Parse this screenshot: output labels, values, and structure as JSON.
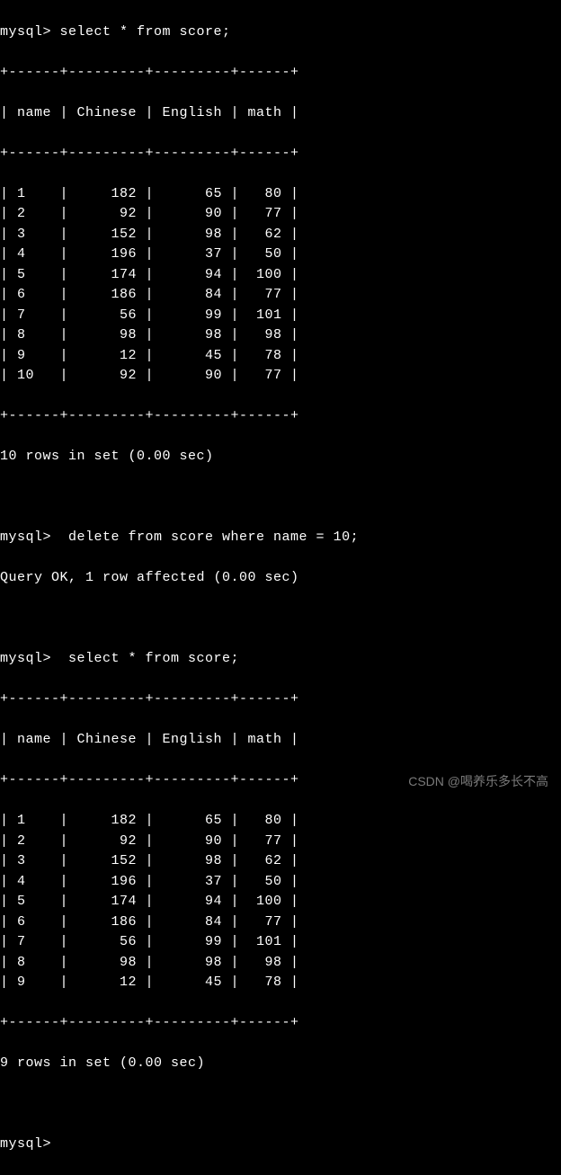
{
  "prompt": "mysql>",
  "queries": {
    "select1": " select * from score;",
    "delete": "  delete from score where name = 10;",
    "select2": "  select * from score;"
  },
  "headers": {
    "name": "name",
    "chinese": "Chinese",
    "english": "English",
    "math": "math"
  },
  "separator_top": "+------+---------+---------+------+",
  "separator": "+------+---------+---------+------+",
  "table1": [
    {
      "name": "1",
      "chinese": "182",
      "english": "65",
      "math": "80"
    },
    {
      "name": "2",
      "chinese": "92",
      "english": "90",
      "math": "77"
    },
    {
      "name": "3",
      "chinese": "152",
      "english": "98",
      "math": "62"
    },
    {
      "name": "4",
      "chinese": "196",
      "english": "37",
      "math": "50"
    },
    {
      "name": "5",
      "chinese": "174",
      "english": "94",
      "math": "100"
    },
    {
      "name": "6",
      "chinese": "186",
      "english": "84",
      "math": "77"
    },
    {
      "name": "7",
      "chinese": "56",
      "english": "99",
      "math": "101"
    },
    {
      "name": "8",
      "chinese": "98",
      "english": "98",
      "math": "98"
    },
    {
      "name": "9",
      "chinese": "12",
      "english": "45",
      "math": "78"
    },
    {
      "name": "10",
      "chinese": "92",
      "english": "90",
      "math": "77"
    }
  ],
  "result1": "10 rows in set (0.00 sec)",
  "delete_result": "Query OK, 1 row affected (0.00 sec)",
  "table2": [
    {
      "name": "1",
      "chinese": "182",
      "english": "65",
      "math": "80"
    },
    {
      "name": "2",
      "chinese": "92",
      "english": "90",
      "math": "77"
    },
    {
      "name": "3",
      "chinese": "152",
      "english": "98",
      "math": "62"
    },
    {
      "name": "4",
      "chinese": "196",
      "english": "37",
      "math": "50"
    },
    {
      "name": "5",
      "chinese": "174",
      "english": "94",
      "math": "100"
    },
    {
      "name": "6",
      "chinese": "186",
      "english": "84",
      "math": "77"
    },
    {
      "name": "7",
      "chinese": "56",
      "english": "99",
      "math": "101"
    },
    {
      "name": "8",
      "chinese": "98",
      "english": "98",
      "math": "98"
    },
    {
      "name": "9",
      "chinese": "12",
      "english": "45",
      "math": "78"
    }
  ],
  "result2": "9 rows in set (0.00 sec)",
  "final_prompt": "mysql>",
  "watermark": "CSDN @喝养乐多长不高"
}
